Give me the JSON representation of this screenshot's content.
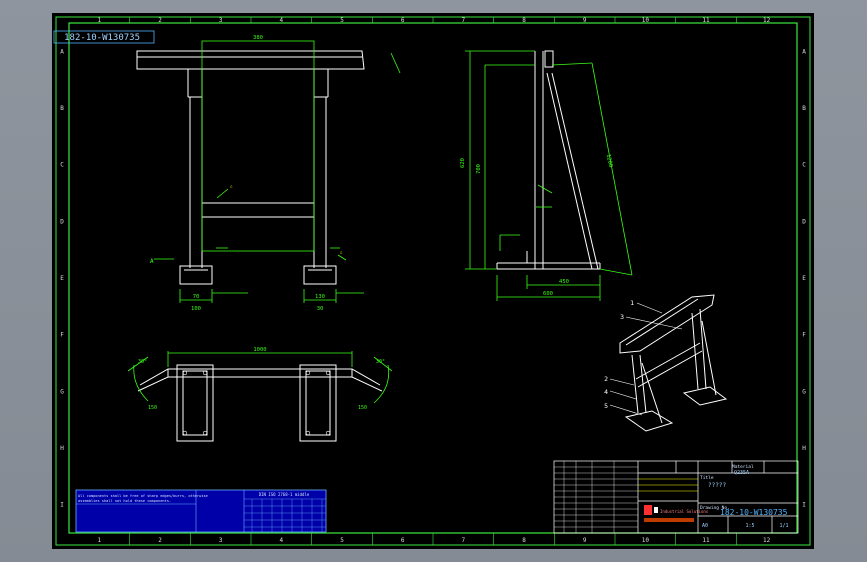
{
  "drawing": {
    "corner_number": "182-10-W130735",
    "zone_letters": [
      "A",
      "B",
      "C",
      "D",
      "E",
      "F",
      "G",
      "H",
      "I"
    ],
    "zone_numbers": [
      "1",
      "2",
      "3",
      "4",
      "5",
      "6",
      "7",
      "8",
      "9",
      "10",
      "11",
      "12"
    ]
  },
  "front_view": {
    "top_dim": "380",
    "foot_dims": [
      "70",
      "100",
      "130",
      "30"
    ],
    "section_mark": "A"
  },
  "side_view": {
    "dims": [
      "620",
      "700",
      "1200",
      "600",
      "450"
    ]
  },
  "plan_view": {
    "top_dim": "1000",
    "angle_dims": [
      "30°",
      "30°",
      "150",
      "150"
    ]
  },
  "balloons": [
    "1",
    "2",
    "3",
    "4",
    "5"
  ],
  "title_block": {
    "drawing_no_label": "Drawing No.",
    "drawing_no": "182-10-W130735",
    "material_label": "Material",
    "material": "Q235A",
    "title_label": "Title",
    "title": "?????",
    "scale": "1:5",
    "sheet": "1/1",
    "company": "Industrial Solutions",
    "revision": "A0"
  },
  "notes": {
    "line1": "All components shall be free of sharp edges/burrs, otherwise",
    "line2": "assemblies shall not hold these components.",
    "tol_title": "DIN ISO 2768-1 middle"
  },
  "colors": {
    "line": "#ffffff",
    "dim": "#39ff14",
    "note_fill": "#0000a8",
    "accent": "#ff3030",
    "border": "#3ce83c"
  }
}
